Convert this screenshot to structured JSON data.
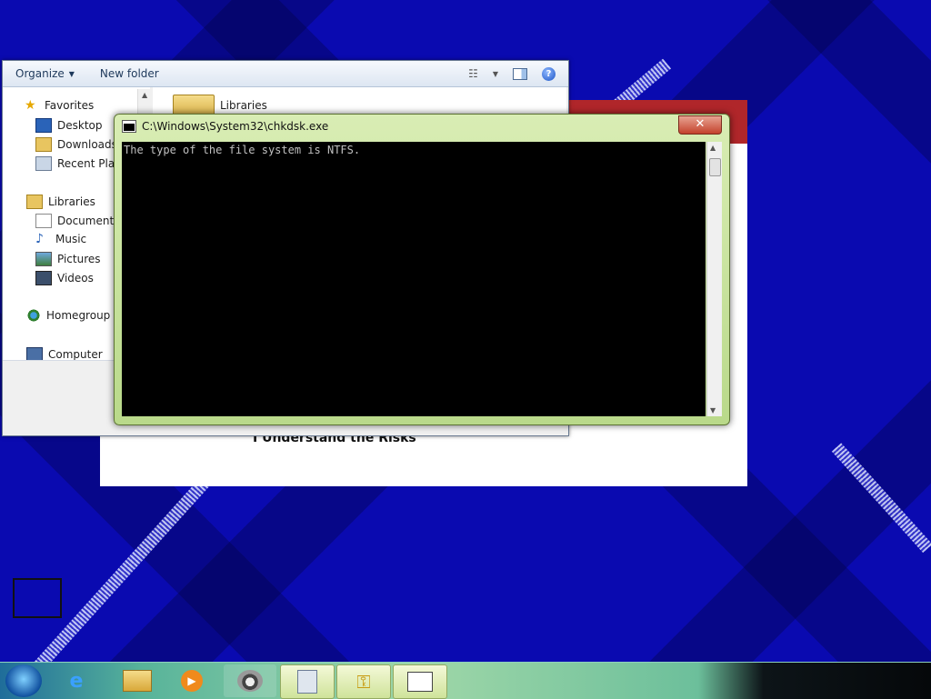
{
  "explorer": {
    "toolbar": {
      "organize": "Organize",
      "new_folder": "New folder"
    },
    "libraries_header": "Libraries",
    "nav": {
      "favorites": "Favorites",
      "desktop": "Desktop",
      "downloads": "Downloads",
      "recent_places": "Recent Places",
      "libraries": "Libraries",
      "documents": "Documents",
      "music": "Music",
      "pictures": "Pictures",
      "videos": "Videos",
      "homegroup": "Homegroup",
      "computer": "Computer"
    }
  },
  "console": {
    "title": "C:\\Windows\\System32\\chkdsk.exe",
    "output": "The type of the file system is NTFS."
  },
  "background_window": {
    "risk_text": "I Understand the Risks"
  }
}
